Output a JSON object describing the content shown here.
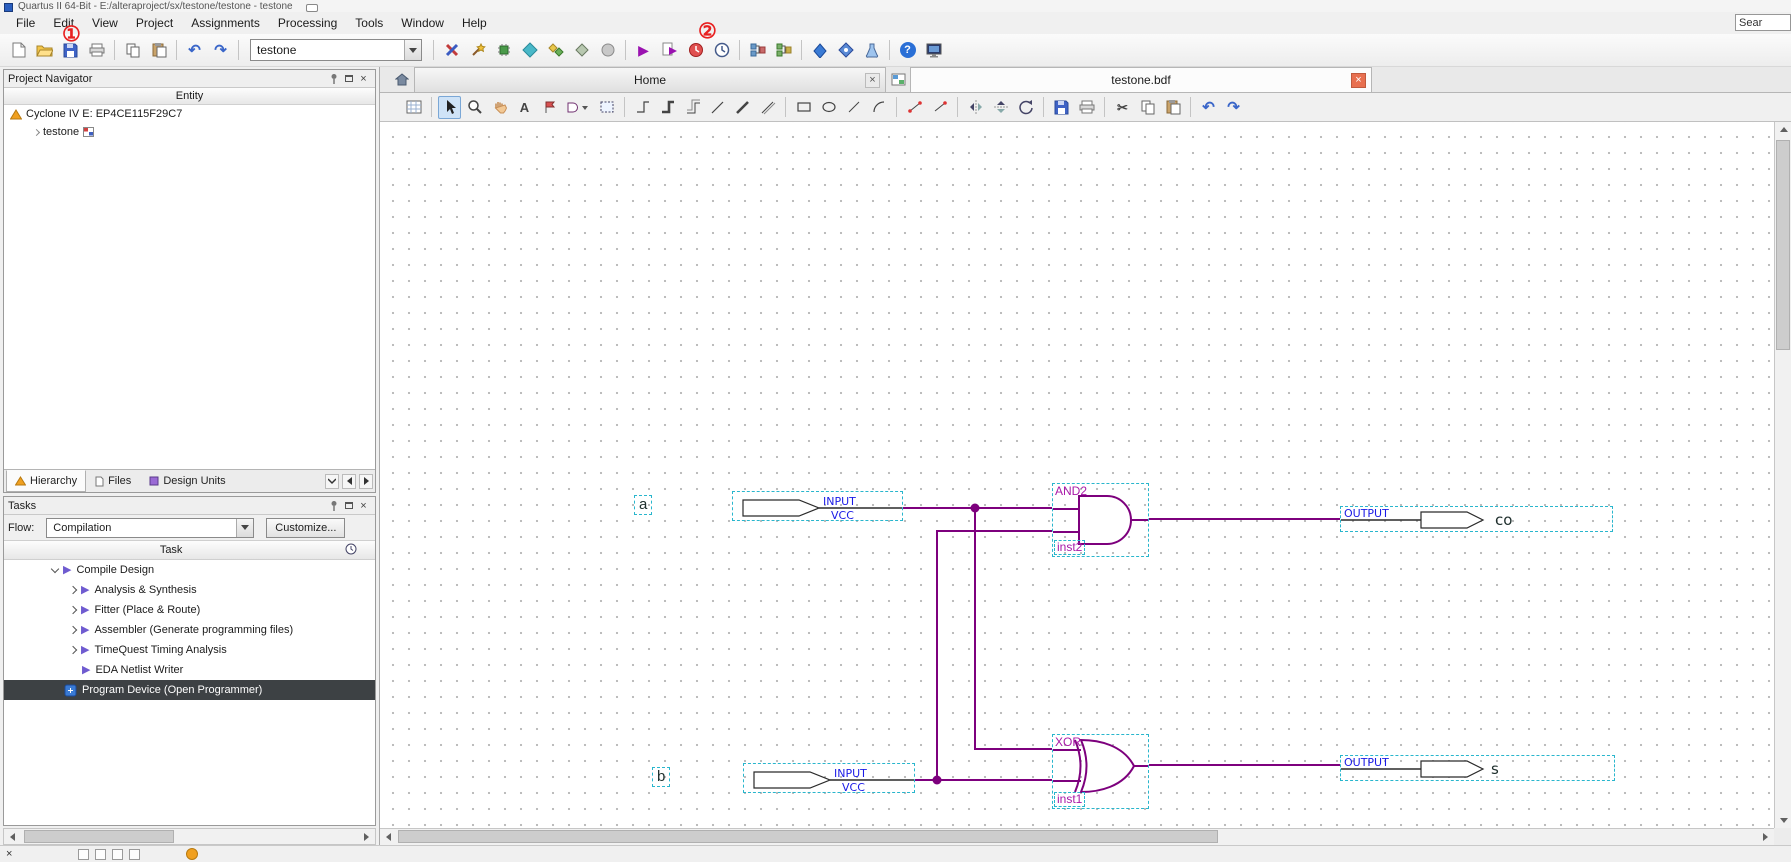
{
  "window": {
    "title": "Quartus II 64-Bit - E:/alteraproject/sx/testone/testone - testone"
  },
  "annotations": {
    "one": "①",
    "two": "②"
  },
  "menu": {
    "items": [
      "File",
      "Edit",
      "View",
      "Project",
      "Assignments",
      "Processing",
      "Tools",
      "Window",
      "Help"
    ]
  },
  "search": {
    "value": "Sear"
  },
  "glyphs": {
    "close": "×",
    "play": "▶",
    "undo": "↶",
    "redo": "↷",
    "help": "?",
    "cut": "✂",
    "text_tool": "A"
  },
  "main_toolbar": {
    "project_combo_value": "testone",
    "icon_names": [
      "new-file",
      "open-file",
      "save",
      "print",
      "copy",
      "paste",
      "undo",
      "redo",
      "settings",
      "assignment-editor",
      "pin-planner",
      "timequest",
      "eda-tools",
      "compile-monitor",
      "power-analyzer",
      "start-compilation",
      "start-analysis-synthesis",
      "stop-processing",
      "timing-analyzer",
      "rtl-viewer",
      "technology-map-viewer",
      "compilation-report",
      "design-assistant",
      "in-system-editor",
      "help",
      "device-window"
    ]
  },
  "project_navigator": {
    "title": "Project Navigator",
    "column_header": "Entity",
    "tree": [
      {
        "label": "Cyclone IV E: EP4CE115F29C7"
      },
      {
        "label": "testone"
      }
    ],
    "tabs": [
      "Hierarchy",
      "Files",
      "Design Units"
    ]
  },
  "tasks": {
    "title": "Tasks",
    "flow_label": "Flow:",
    "flow_value": "Compilation",
    "customize_button": "Customize...",
    "column_header": "Task",
    "rows": [
      {
        "label": "Compile Design"
      },
      {
        "label": "Analysis & Synthesis"
      },
      {
        "label": "Fitter (Place & Route)"
      },
      {
        "label": "Assembler (Generate programming files)"
      },
      {
        "label": "TimeQuest Timing Analysis"
      },
      {
        "label": "EDA Netlist Writer"
      },
      {
        "label": "Program Device (Open Programmer)"
      }
    ]
  },
  "document_tabs": {
    "home": "Home",
    "bdf": "testone.bdf"
  },
  "schematic": {
    "editor_icon_names": [
      "page-setup",
      "select",
      "zoom",
      "pan",
      "text",
      "pin-tool",
      "symbol-tool",
      "block-tool",
      "orthogonal-node-line",
      "orthogonal-bus-line",
      "orthogonal-conduit-line",
      "diagonal-node-line",
      "diagonal-bus-line",
      "diagonal-conduit-line",
      "rectangle-tool",
      "ellipse-tool",
      "line-tool",
      "arc-tool",
      "partial-line-on",
      "partial-line-off",
      "flip-horizontal",
      "flip-vertical",
      "rotate-90",
      "save",
      "print",
      "cut",
      "copy",
      "paste",
      "undo",
      "redo"
    ],
    "input_label": "INPUT",
    "vcc_label": "VCC",
    "output_label": "OUTPUT",
    "pins": {
      "a": "a",
      "b": "b",
      "co": "co",
      "s": "s"
    },
    "and_gate": {
      "type": "AND2",
      "instance": "inst2"
    },
    "xor_gate": {
      "type": "XOR",
      "instance": "inst1"
    }
  },
  "colors": {
    "wire": "#7d007d",
    "schematic_text_blue": "#1a1ae6",
    "selection_dash": "#29b6cd",
    "annotation_red": "#e82020",
    "active_tab_close": "#e87050"
  }
}
